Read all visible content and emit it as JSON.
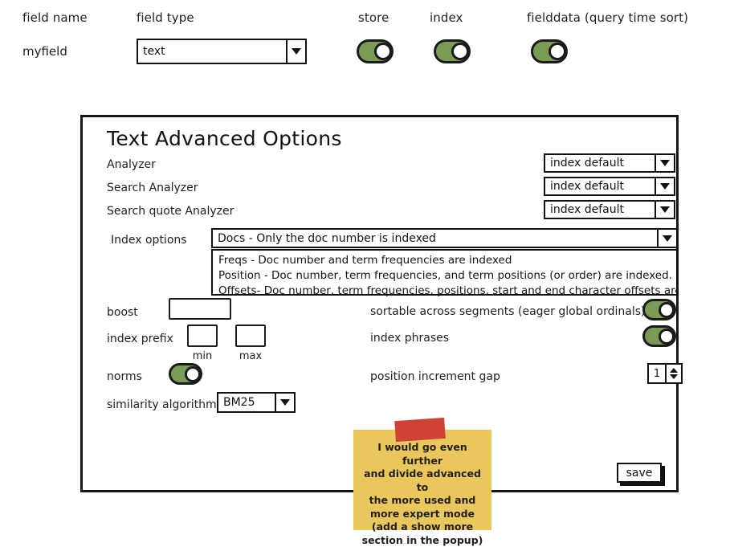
{
  "header": {
    "col_field_name": "field name",
    "col_field_type": "field type",
    "col_store": "store",
    "col_index": "index",
    "col_fielddata": "fielddata (query time sort)"
  },
  "field_row": {
    "field_name_value": "myfield",
    "field_type_value": "text",
    "store_on": true,
    "index_on": true,
    "fielddata_on": true
  },
  "dialog": {
    "title": "Text Advanced Options",
    "analyzer": {
      "label": "Analyzer",
      "value": "index default"
    },
    "search_analyzer": {
      "label": "Search Analyzer",
      "value": "index default"
    },
    "search_quote_analyzer": {
      "label": "Search quote Analyzer",
      "value": "index default"
    },
    "index_options": {
      "label": "Index options",
      "selected": "Docs - Only the doc number is indexed",
      "options": [
        "Freqs - Doc number and term frequencies are indexed",
        "Position - Doc number, term frequencies, and term positions (or order) are indexed.",
        "Offsets- Doc number, term frequencies, positions, start and end character offsets are in"
      ]
    },
    "boost": {
      "label": "boost",
      "value": ""
    },
    "index_prefix": {
      "label": "index prefix",
      "min_value": "",
      "max_value": "",
      "min_caption": "min",
      "max_caption": "max"
    },
    "norms": {
      "label": "norms",
      "on": true
    },
    "similarity_algorithm": {
      "label": "similarity algorithm",
      "value": "BM25"
    },
    "sortable_across_segments": {
      "label": "sortable across segments (eager global ordinals)",
      "on": true
    },
    "index_phrases": {
      "label": "index phrases",
      "on": true
    },
    "position_increment_gap": {
      "label": "position increment gap",
      "value": "1"
    },
    "save_label": "save"
  },
  "sticky_note": {
    "text": "I would go even further\nand divide advanced to\nthe more used and\nmore expert mode\n(add a show more\nsection in the popup)"
  },
  "colors": {
    "toggle_green": "#7a9b55",
    "note_yellow": "#eac75d",
    "tape_red": "#cf4236",
    "ink": "#161616"
  }
}
